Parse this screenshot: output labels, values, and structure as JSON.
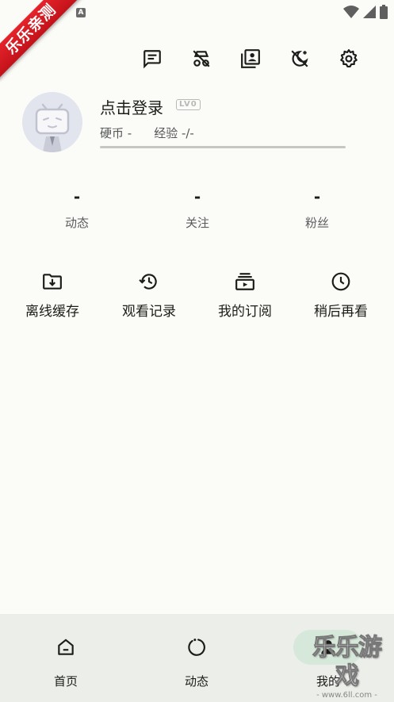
{
  "status_bar": {
    "notification_badge": "A",
    "icons": [
      "wifi-icon",
      "signal-icon",
      "battery-icon"
    ]
  },
  "ribbon": {
    "text": "乐乐亲测"
  },
  "top_actions": [
    {
      "name": "message-icon"
    },
    {
      "name": "incognito-icon"
    },
    {
      "name": "profile-album-icon"
    },
    {
      "name": "dark-mode-icon"
    },
    {
      "name": "settings-icon"
    }
  ],
  "profile": {
    "login_text": "点击登录",
    "level_badge": "LV0",
    "coins": "硬币 -",
    "experience": "经验 -/-"
  },
  "stats": [
    {
      "value": "-",
      "label": "动态"
    },
    {
      "value": "-",
      "label": "关注"
    },
    {
      "value": "-",
      "label": "粉丝"
    }
  ],
  "shortcuts": [
    {
      "label": "离线缓存",
      "icon": "download-folder-icon"
    },
    {
      "label": "观看记录",
      "icon": "history-icon"
    },
    {
      "label": "我的订阅",
      "icon": "subscription-icon"
    },
    {
      "label": "稍后再看",
      "icon": "clock-icon"
    }
  ],
  "bottom_nav": [
    {
      "label": "首页",
      "icon": "home-icon"
    },
    {
      "label": "动态",
      "icon": "dynamic-icon"
    },
    {
      "label": "我的",
      "icon": "person-icon",
      "active": true
    }
  ],
  "watermark": {
    "title": "乐乐游戏",
    "url": "- www.6ll.com -"
  },
  "colors": {
    "background": "#fbfcf7",
    "nav_background": "#eceee9",
    "active_pill": "#d6e8d9",
    "ribbon": "#d81e26"
  }
}
